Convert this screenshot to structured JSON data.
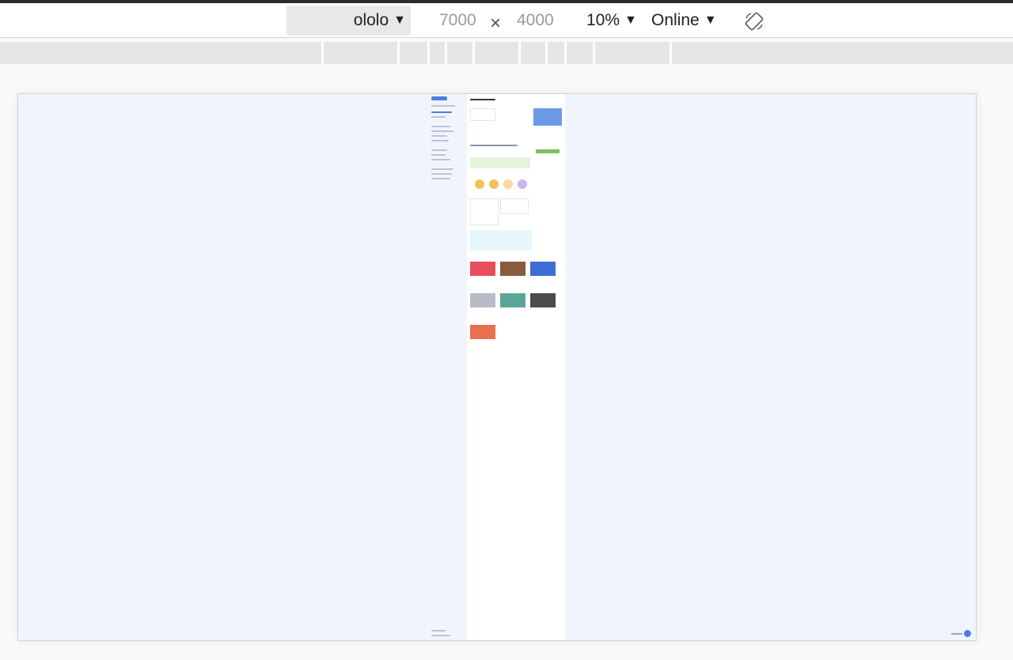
{
  "toolbar": {
    "device": "ololo",
    "width": "7000",
    "times": "×",
    "height": "4000",
    "zoom": "10%",
    "network": "Online",
    "icons": {
      "dropdown": "chevron-down-icon",
      "rotate": "rotate-device-icon"
    }
  },
  "colors": {
    "canvas_bg": "#f1f4fd",
    "accent": "#4a7fe0",
    "ruler": "#e6e6e6"
  }
}
